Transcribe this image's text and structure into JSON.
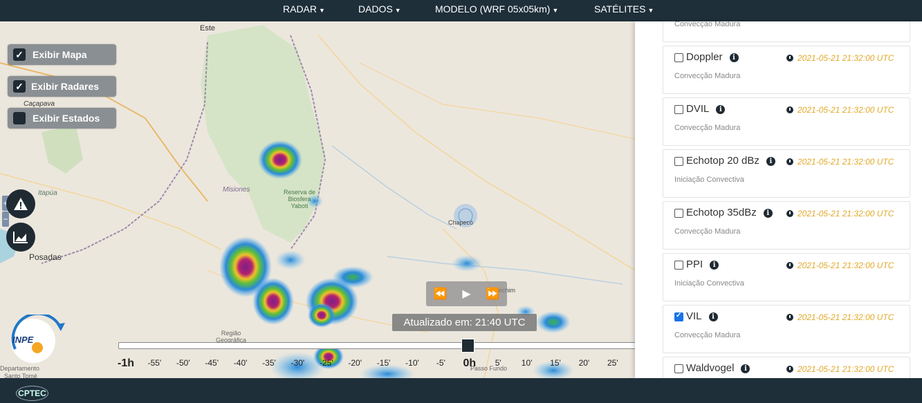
{
  "nav": {
    "items": [
      {
        "label": "RADAR"
      },
      {
        "label": "DADOS"
      },
      {
        "label": "MODELO (WRF 05x05km)"
      },
      {
        "label": "SATÉLITES"
      }
    ]
  },
  "map_controls": {
    "show_map": {
      "label": "Exibir Mapa",
      "checked": true
    },
    "show_radars": {
      "label": "Exibir Radares",
      "checked": true
    },
    "show_states": {
      "label": "Exibir Estados",
      "checked": false
    }
  },
  "map_labels": {
    "este": "Este",
    "cacapava": "Caçapava",
    "itapua": "Itapúa",
    "misiones": "Misiones",
    "reserva1": "Reserva de",
    "reserva2": "Biosfera",
    "reserva3": "Yaboti",
    "posadas": "Posadas",
    "chapeco": "Chapecó",
    "erechim": "Erechim",
    "regiao1": "Região",
    "regiao2": "Geográfica",
    "departamento": "Departamento",
    "santo_tome": "Santo Tomé",
    "passo_fundo": "Passo Fundo"
  },
  "updated_text": "Atualizado em: 21:40 UTC",
  "player": {
    "rewind_icon": "rewind-icon",
    "play_icon": "play-icon",
    "forward_icon": "fast-forward-icon"
  },
  "timeline": {
    "ticks": [
      "-1h",
      "-55'",
      "-50'",
      "-45'",
      "-40'",
      "-35'",
      "-30'",
      "-25'",
      "-20'",
      "-15'",
      "-10'",
      "-5'",
      "0h",
      "5'",
      "10'",
      "15'",
      "20'",
      "25'"
    ],
    "current": "0h"
  },
  "products": [
    {
      "name": "",
      "sub": "Convecção Madura",
      "time": "",
      "checked": false,
      "partial": true
    },
    {
      "name": "Doppler",
      "sub": "Convecção Madura",
      "time": "2021-05-21 21:32:00 UTC",
      "checked": false
    },
    {
      "name": "DVIL",
      "sub": "Convecção Madura",
      "time": "2021-05-21 21:32:00 UTC",
      "checked": false
    },
    {
      "name": "Echotop 20 dBz",
      "sub": "Iniciação Convectiva",
      "time": "2021-05-21 21:32:00 UTC",
      "checked": false
    },
    {
      "name": "Echotop 35dBz",
      "sub": "Convecção Madura",
      "time": "2021-05-21 21:32:00 UTC",
      "checked": false
    },
    {
      "name": "PPI",
      "sub": "Iniciação Convectiva",
      "time": "2021-05-21 21:32:00 UTC",
      "checked": false
    },
    {
      "name": "VIL",
      "sub": "Convecção Madura",
      "time": "2021-05-21 21:32:00 UTC",
      "checked": true
    },
    {
      "name": "Waldvogel",
      "sub": "",
      "time": "2021-05-21 21:32:00 UTC",
      "checked": false
    }
  ],
  "logos": {
    "inpe": "INPE",
    "cptec": "CPTEC"
  }
}
